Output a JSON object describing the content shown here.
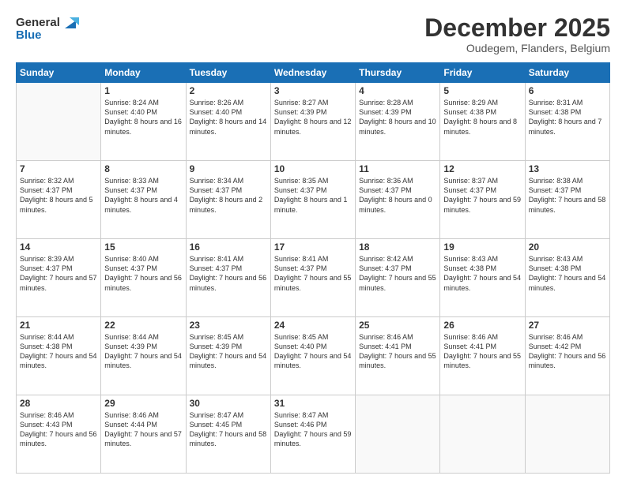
{
  "logo": {
    "line1": "General",
    "line2": "Blue"
  },
  "header": {
    "month": "December 2025",
    "location": "Oudegem, Flanders, Belgium"
  },
  "weekdays": [
    "Sunday",
    "Monday",
    "Tuesday",
    "Wednesday",
    "Thursday",
    "Friday",
    "Saturday"
  ],
  "weeks": [
    [
      {
        "day": "",
        "empty": true
      },
      {
        "day": "1",
        "sunrise": "Sunrise: 8:24 AM",
        "sunset": "Sunset: 4:40 PM",
        "daylight": "Daylight: 8 hours and 16 minutes."
      },
      {
        "day": "2",
        "sunrise": "Sunrise: 8:26 AM",
        "sunset": "Sunset: 4:40 PM",
        "daylight": "Daylight: 8 hours and 14 minutes."
      },
      {
        "day": "3",
        "sunrise": "Sunrise: 8:27 AM",
        "sunset": "Sunset: 4:39 PM",
        "daylight": "Daylight: 8 hours and 12 minutes."
      },
      {
        "day": "4",
        "sunrise": "Sunrise: 8:28 AM",
        "sunset": "Sunset: 4:39 PM",
        "daylight": "Daylight: 8 hours and 10 minutes."
      },
      {
        "day": "5",
        "sunrise": "Sunrise: 8:29 AM",
        "sunset": "Sunset: 4:38 PM",
        "daylight": "Daylight: 8 hours and 8 minutes."
      },
      {
        "day": "6",
        "sunrise": "Sunrise: 8:31 AM",
        "sunset": "Sunset: 4:38 PM",
        "daylight": "Daylight: 8 hours and 7 minutes."
      }
    ],
    [
      {
        "day": "7",
        "sunrise": "Sunrise: 8:32 AM",
        "sunset": "Sunset: 4:37 PM",
        "daylight": "Daylight: 8 hours and 5 minutes."
      },
      {
        "day": "8",
        "sunrise": "Sunrise: 8:33 AM",
        "sunset": "Sunset: 4:37 PM",
        "daylight": "Daylight: 8 hours and 4 minutes."
      },
      {
        "day": "9",
        "sunrise": "Sunrise: 8:34 AM",
        "sunset": "Sunset: 4:37 PM",
        "daylight": "Daylight: 8 hours and 2 minutes."
      },
      {
        "day": "10",
        "sunrise": "Sunrise: 8:35 AM",
        "sunset": "Sunset: 4:37 PM",
        "daylight": "Daylight: 8 hours and 1 minute."
      },
      {
        "day": "11",
        "sunrise": "Sunrise: 8:36 AM",
        "sunset": "Sunset: 4:37 PM",
        "daylight": "Daylight: 8 hours and 0 minutes."
      },
      {
        "day": "12",
        "sunrise": "Sunrise: 8:37 AM",
        "sunset": "Sunset: 4:37 PM",
        "daylight": "Daylight: 7 hours and 59 minutes."
      },
      {
        "day": "13",
        "sunrise": "Sunrise: 8:38 AM",
        "sunset": "Sunset: 4:37 PM",
        "daylight": "Daylight: 7 hours and 58 minutes."
      }
    ],
    [
      {
        "day": "14",
        "sunrise": "Sunrise: 8:39 AM",
        "sunset": "Sunset: 4:37 PM",
        "daylight": "Daylight: 7 hours and 57 minutes."
      },
      {
        "day": "15",
        "sunrise": "Sunrise: 8:40 AM",
        "sunset": "Sunset: 4:37 PM",
        "daylight": "Daylight: 7 hours and 56 minutes."
      },
      {
        "day": "16",
        "sunrise": "Sunrise: 8:41 AM",
        "sunset": "Sunset: 4:37 PM",
        "daylight": "Daylight: 7 hours and 56 minutes."
      },
      {
        "day": "17",
        "sunrise": "Sunrise: 8:41 AM",
        "sunset": "Sunset: 4:37 PM",
        "daylight": "Daylight: 7 hours and 55 minutes."
      },
      {
        "day": "18",
        "sunrise": "Sunrise: 8:42 AM",
        "sunset": "Sunset: 4:37 PM",
        "daylight": "Daylight: 7 hours and 55 minutes."
      },
      {
        "day": "19",
        "sunrise": "Sunrise: 8:43 AM",
        "sunset": "Sunset: 4:38 PM",
        "daylight": "Daylight: 7 hours and 54 minutes."
      },
      {
        "day": "20",
        "sunrise": "Sunrise: 8:43 AM",
        "sunset": "Sunset: 4:38 PM",
        "daylight": "Daylight: 7 hours and 54 minutes."
      }
    ],
    [
      {
        "day": "21",
        "sunrise": "Sunrise: 8:44 AM",
        "sunset": "Sunset: 4:38 PM",
        "daylight": "Daylight: 7 hours and 54 minutes."
      },
      {
        "day": "22",
        "sunrise": "Sunrise: 8:44 AM",
        "sunset": "Sunset: 4:39 PM",
        "daylight": "Daylight: 7 hours and 54 minutes."
      },
      {
        "day": "23",
        "sunrise": "Sunrise: 8:45 AM",
        "sunset": "Sunset: 4:39 PM",
        "daylight": "Daylight: 7 hours and 54 minutes."
      },
      {
        "day": "24",
        "sunrise": "Sunrise: 8:45 AM",
        "sunset": "Sunset: 4:40 PM",
        "daylight": "Daylight: 7 hours and 54 minutes."
      },
      {
        "day": "25",
        "sunrise": "Sunrise: 8:46 AM",
        "sunset": "Sunset: 4:41 PM",
        "daylight": "Daylight: 7 hours and 55 minutes."
      },
      {
        "day": "26",
        "sunrise": "Sunrise: 8:46 AM",
        "sunset": "Sunset: 4:41 PM",
        "daylight": "Daylight: 7 hours and 55 minutes."
      },
      {
        "day": "27",
        "sunrise": "Sunrise: 8:46 AM",
        "sunset": "Sunset: 4:42 PM",
        "daylight": "Daylight: 7 hours and 56 minutes."
      }
    ],
    [
      {
        "day": "28",
        "sunrise": "Sunrise: 8:46 AM",
        "sunset": "Sunset: 4:43 PM",
        "daylight": "Daylight: 7 hours and 56 minutes."
      },
      {
        "day": "29",
        "sunrise": "Sunrise: 8:46 AM",
        "sunset": "Sunset: 4:44 PM",
        "daylight": "Daylight: 7 hours and 57 minutes."
      },
      {
        "day": "30",
        "sunrise": "Sunrise: 8:47 AM",
        "sunset": "Sunset: 4:45 PM",
        "daylight": "Daylight: 7 hours and 58 minutes."
      },
      {
        "day": "31",
        "sunrise": "Sunrise: 8:47 AM",
        "sunset": "Sunset: 4:46 PM",
        "daylight": "Daylight: 7 hours and 59 minutes."
      },
      {
        "day": "",
        "empty": true
      },
      {
        "day": "",
        "empty": true
      },
      {
        "day": "",
        "empty": true
      }
    ]
  ]
}
